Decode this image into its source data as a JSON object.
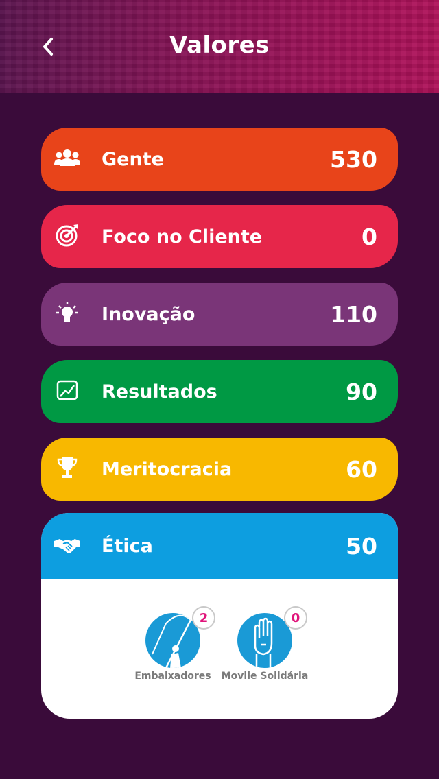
{
  "header": {
    "title": "Valores",
    "back_icon": "chevron-left-icon"
  },
  "values": [
    {
      "label": "Gente",
      "value": "530",
      "icon": "people-icon",
      "color": "#e8441a"
    },
    {
      "label": "Foco no Cliente",
      "value": "0",
      "icon": "target-icon",
      "color": "#e6264a"
    },
    {
      "label": "Inovação",
      "value": "110",
      "icon": "lightbulb-icon",
      "color": "#7a3578"
    },
    {
      "label": "Resultados",
      "value": "90",
      "icon": "chart-up-icon",
      "color": "#009944"
    },
    {
      "label": "Meritocracia",
      "value": "60",
      "icon": "trophy-icon",
      "color": "#f8b800"
    },
    {
      "label": "Ética",
      "value": "50",
      "icon": "handshake-icon",
      "color": "#0d9ee0"
    }
  ],
  "badges": [
    {
      "label": "Embaixadores",
      "count": "2",
      "icon": "flag-person-icon"
    },
    {
      "label": "Movile Solidária",
      "count": "0",
      "icon": "raised-hand-icon"
    }
  ]
}
